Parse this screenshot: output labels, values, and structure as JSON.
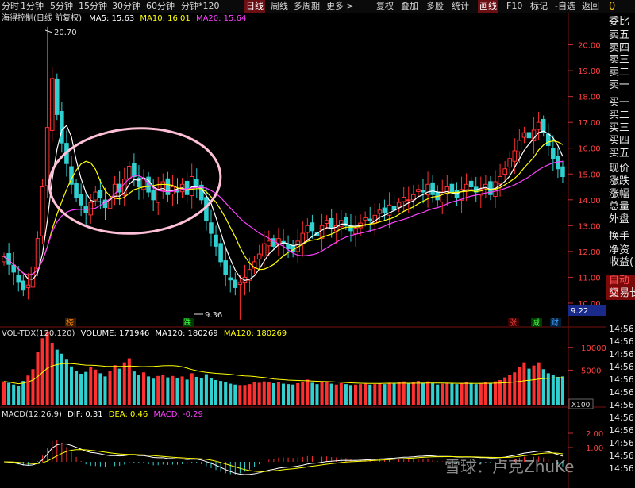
{
  "toolbar": {
    "items": [
      "分时",
      "1分钟",
      "5分钟",
      "15分钟",
      "30分钟",
      "60分钟",
      "分钟*120",
      "日线",
      "周线",
      "多周期",
      "更多 >",
      "复权",
      "叠加",
      "多股",
      "统计",
      "画线",
      "F10",
      "标记",
      "-自选",
      "返回"
    ],
    "active_label": "日线"
  },
  "price_pane": {
    "title": "海得控制(日线 前复权)",
    "ma5": "MA5: 15.63",
    "ma10": "MA10: 16.01",
    "ma20": "MA20: 15.64",
    "high_label": "20.70",
    "low_label": "9.36",
    "marker_left": "榜",
    "marker_mid": "跌",
    "marker_right": [
      "涨",
      "减",
      "财"
    ],
    "current_price": "9.22"
  },
  "volume_pane": {
    "title": "VOL-TDX(120,120)",
    "volume": "VOLUME: 171946",
    "ma120_a": "MA120: 180269",
    "ma120_b": "MA120: 180269",
    "unit": "X100"
  },
  "macd_pane": {
    "title": "MACD(12,26,9)",
    "dif": "DIF: 0.31",
    "dea": "DEA: 0.46",
    "macd": "MACD: -0.29"
  },
  "right_panel": {
    "top_char": "0",
    "labels": [
      "委比",
      "卖五",
      "卖四",
      "卖三",
      "卖二",
      "卖一",
      "买一",
      "买二",
      "买三",
      "买四",
      "买五",
      "现价",
      "涨跌",
      "涨幅",
      "总量",
      "外盘",
      "换手",
      "净资",
      "收益(",
      "自动组",
      "交易长"
    ],
    "times": [
      "14:56",
      "14:56",
      "14:56",
      "14:56",
      "14:56",
      "14:56",
      "14:56",
      "14:56",
      "14:56",
      "14:56",
      "14:56",
      "14:56"
    ]
  },
  "watermark": "雪球：卢克ZhuKe",
  "chart_data": [
    {
      "type": "candlestick",
      "title": "海得控制(日线 前复权)",
      "y_ticks": [
        20.0,
        19.0,
        18.0,
        17.0,
        16.0,
        15.0,
        14.0,
        13.0,
        12.0,
        11.0,
        10.0
      ],
      "ylim": [
        9.2,
        21.0
      ],
      "annotations": [
        {
          "label": "20.70"
        },
        {
          "label": "9.36"
        }
      ],
      "series": [
        {
          "name": "MA5",
          "value": 15.63,
          "color": "#ffffff"
        },
        {
          "name": "MA10",
          "value": 16.01,
          "color": "#ffff00"
        },
        {
          "name": "MA20",
          "value": 15.64,
          "color": "#ff00ff"
        }
      ],
      "close": [
        11.8,
        11.5,
        11.2,
        10.8,
        10.5,
        10.7,
        11.4,
        12.5,
        14.5,
        16.8,
        18.7,
        17.3,
        16.2,
        15.4,
        14.6,
        14.1,
        13.8,
        13.5,
        13.9,
        14.3,
        14.1,
        13.7,
        14.0,
        14.6,
        14.3,
        14.8,
        15.3,
        14.9,
        14.5,
        14.8,
        14.3,
        14.0,
        14.4,
        14.7,
        14.2,
        14.5,
        14.3,
        14.6,
        14.2,
        14.9,
        14.5,
        14.0,
        13.2,
        12.7,
        12.2,
        11.6,
        11.1,
        10.9,
        10.6,
        10.8,
        11.0,
        11.3,
        11.6,
        11.9,
        12.3,
        12.4,
        12.2,
        12.5,
        12.3,
        12.1,
        12.0,
        12.4,
        12.7,
        13.0,
        12.8,
        12.6,
        13.0,
        13.2,
        12.9,
        13.0,
        13.2,
        13.0,
        12.8,
        12.9,
        13.1,
        13.3,
        13.2,
        13.4,
        13.6,
        13.5,
        13.8,
        13.6,
        13.9,
        14.1,
        14.0,
        14.2,
        14.4,
        14.3,
        14.6,
        14.2,
        14.0,
        14.3,
        14.5,
        14.3,
        14.1,
        14.4,
        14.6,
        14.5,
        14.3,
        14.4,
        14.6,
        14.2,
        14.7,
        14.9,
        15.2,
        15.6,
        15.9,
        16.3,
        16.6,
        16.4,
        16.7,
        17.0,
        16.6,
        16.1,
        15.6,
        15.2,
        14.9
      ]
    },
    {
      "type": "bar",
      "title": "VOL-TDX(120,120)",
      "y_ticks": [
        10000,
        5000
      ],
      "values": [
        2500,
        2200,
        1800,
        1500,
        2600,
        3800,
        5200,
        9000,
        12000,
        13500,
        11000,
        9500,
        8600,
        7300,
        5800,
        4800,
        4200,
        4600,
        5600,
        5100,
        4300,
        3600,
        4900,
        6100,
        5300,
        6700,
        7600,
        4700,
        3900,
        4500,
        3600,
        3100,
        3700,
        4000,
        3400,
        3700,
        3200,
        3600,
        2900,
        4300,
        3500,
        3200,
        4100,
        3300,
        2800,
        2600,
        2300,
        2000,
        1800,
        1700,
        1700,
        1900,
        2300,
        2200,
        2500,
        2400,
        2100,
        2300,
        2000,
        1900,
        1800,
        2100,
        2400,
        2900,
        2200,
        1900,
        2300,
        2500,
        2000,
        1800,
        2100,
        1900,
        1700,
        1800,
        1900,
        2000,
        1800,
        1900,
        2100,
        1900,
        2200,
        2000,
        2300,
        2500,
        2100,
        2400,
        2600,
        2200,
        2500,
        2100,
        1800,
        2000,
        2200,
        2000,
        1900,
        2100,
        2300,
        2100,
        1900,
        2000,
        2400,
        2100,
        2500,
        2800,
        3400,
        3900,
        4500,
        5600,
        6700,
        5300,
        6000,
        6700,
        5200,
        4300,
        3900,
        3500,
        3600
      ]
    },
    {
      "type": "line",
      "title": "MACD(12,26,9)",
      "y_ticks": [
        2.0,
        1.0
      ],
      "series": [
        {
          "name": "DIF",
          "value": 0.31
        },
        {
          "name": "DEA",
          "value": 0.46
        },
        {
          "name": "MACD",
          "value": -0.29
        }
      ]
    }
  ]
}
